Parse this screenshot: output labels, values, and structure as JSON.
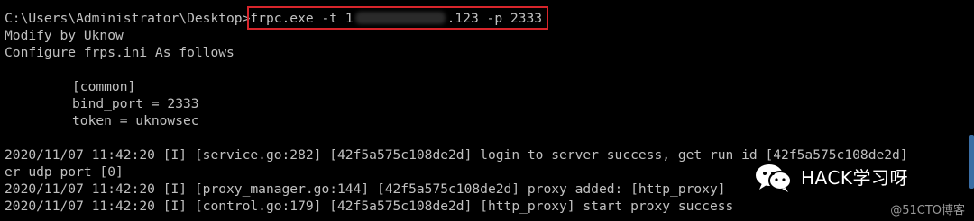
{
  "terminal": {
    "prompt": "C:\\Users\\Administrator\\Desktop>",
    "command_start": "frpc.exe -t ",
    "command_mid": "1",
    "command_end": ".123 -p 2333",
    "lines": [
      "Modify by Uknow",
      "Configure frps.ini As follows",
      "",
      "[common]",
      "bind_port = 2333",
      "token = uknowsec",
      "",
      "2020/11/07 11:42:20 [I] [service.go:282] [42f5a575c108de2d] login to server success, get run id [42f5a575c108de2d]",
      "er udp port [0]",
      "2020/11/07 11:42:20 [I] [proxy_manager.go:144] [42f5a575c108de2d] proxy added: [http_proxy]",
      "2020/11/07 11:42:20 [I] [control.go:179] [42f5a575c108de2d] [http_proxy] start proxy success"
    ]
  },
  "watermark": {
    "text": "HACK学习呀",
    "icon": "wechat-icon"
  },
  "source_mark": "@51CTO博客",
  "colors": {
    "background": "#000000",
    "text": "#c0c0c0",
    "highlight_box": "#d8252b"
  }
}
